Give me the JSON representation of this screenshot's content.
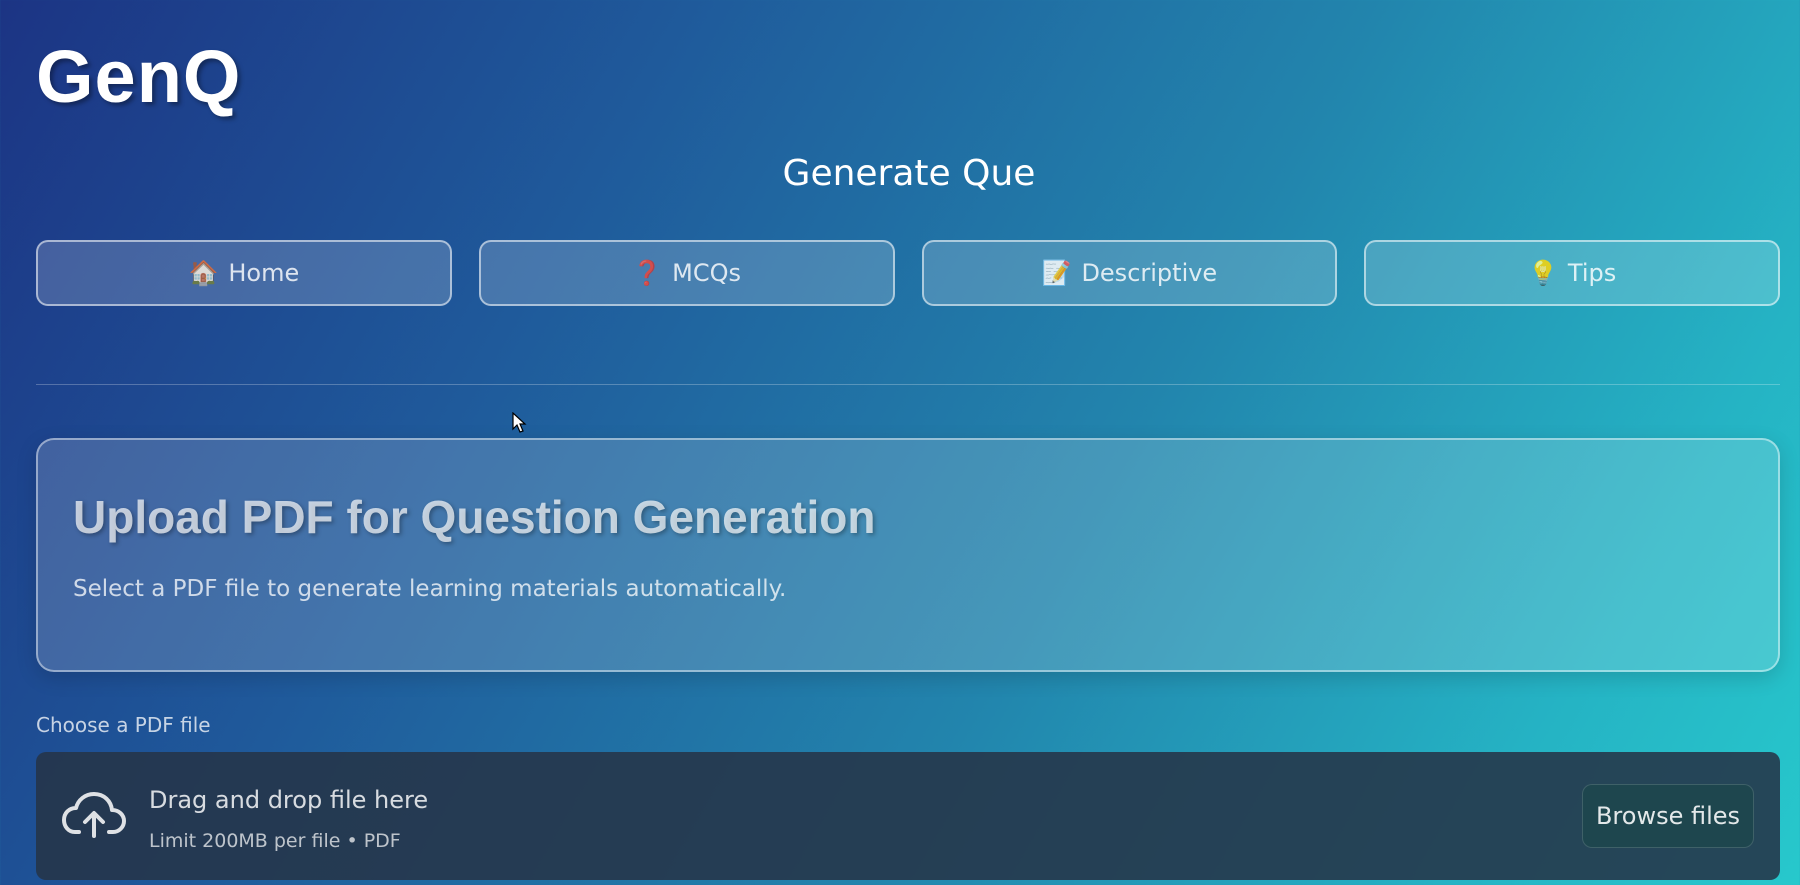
{
  "app": {
    "logo": "GenQ",
    "subtitle": "Generate Que"
  },
  "nav": {
    "items": [
      {
        "icon": "🏠",
        "label": "Home"
      },
      {
        "icon": "❓",
        "label": "MCQs"
      },
      {
        "icon": "📝",
        "label": "Descriptive"
      },
      {
        "icon": "💡",
        "label": "Tips"
      }
    ]
  },
  "upload_card": {
    "title": "Upload PDF for Question Generation",
    "description": "Select a PDF file to generate learning materials automatically."
  },
  "uploader": {
    "label": "Choose a PDF file",
    "drop_title": "Drag and drop file here",
    "drop_limit": "Limit 200MB per file • PDF",
    "browse_label": "Browse files"
  }
}
